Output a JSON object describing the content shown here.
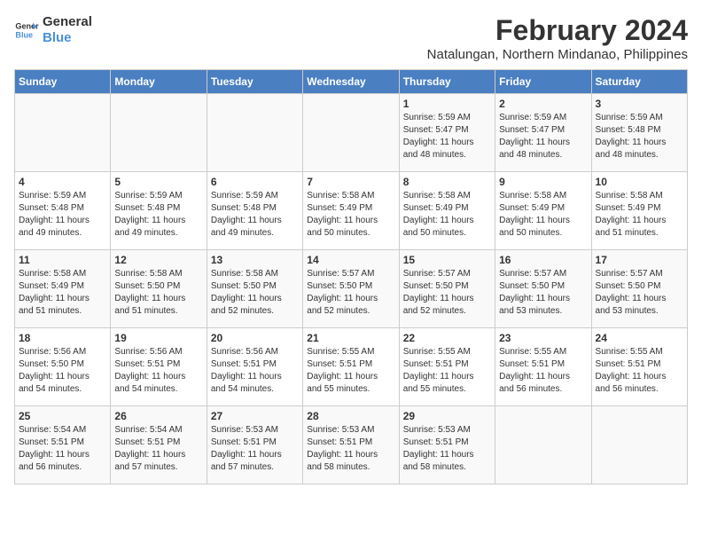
{
  "logo": {
    "line1": "General",
    "line2": "Blue"
  },
  "title": "February 2024",
  "location": "Natalungan, Northern Mindanao, Philippines",
  "days_of_week": [
    "Sunday",
    "Monday",
    "Tuesday",
    "Wednesday",
    "Thursday",
    "Friday",
    "Saturday"
  ],
  "weeks": [
    [
      {
        "day": "",
        "text": ""
      },
      {
        "day": "",
        "text": ""
      },
      {
        "day": "",
        "text": ""
      },
      {
        "day": "",
        "text": ""
      },
      {
        "day": "1",
        "text": "Sunrise: 5:59 AM\nSunset: 5:47 PM\nDaylight: 11 hours\nand 48 minutes."
      },
      {
        "day": "2",
        "text": "Sunrise: 5:59 AM\nSunset: 5:47 PM\nDaylight: 11 hours\nand 48 minutes."
      },
      {
        "day": "3",
        "text": "Sunrise: 5:59 AM\nSunset: 5:48 PM\nDaylight: 11 hours\nand 48 minutes."
      }
    ],
    [
      {
        "day": "4",
        "text": "Sunrise: 5:59 AM\nSunset: 5:48 PM\nDaylight: 11 hours\nand 49 minutes."
      },
      {
        "day": "5",
        "text": "Sunrise: 5:59 AM\nSunset: 5:48 PM\nDaylight: 11 hours\nand 49 minutes."
      },
      {
        "day": "6",
        "text": "Sunrise: 5:59 AM\nSunset: 5:48 PM\nDaylight: 11 hours\nand 49 minutes."
      },
      {
        "day": "7",
        "text": "Sunrise: 5:58 AM\nSunset: 5:49 PM\nDaylight: 11 hours\nand 50 minutes."
      },
      {
        "day": "8",
        "text": "Sunrise: 5:58 AM\nSunset: 5:49 PM\nDaylight: 11 hours\nand 50 minutes."
      },
      {
        "day": "9",
        "text": "Sunrise: 5:58 AM\nSunset: 5:49 PM\nDaylight: 11 hours\nand 50 minutes."
      },
      {
        "day": "10",
        "text": "Sunrise: 5:58 AM\nSunset: 5:49 PM\nDaylight: 11 hours\nand 51 minutes."
      }
    ],
    [
      {
        "day": "11",
        "text": "Sunrise: 5:58 AM\nSunset: 5:49 PM\nDaylight: 11 hours\nand 51 minutes."
      },
      {
        "day": "12",
        "text": "Sunrise: 5:58 AM\nSunset: 5:50 PM\nDaylight: 11 hours\nand 51 minutes."
      },
      {
        "day": "13",
        "text": "Sunrise: 5:58 AM\nSunset: 5:50 PM\nDaylight: 11 hours\nand 52 minutes."
      },
      {
        "day": "14",
        "text": "Sunrise: 5:57 AM\nSunset: 5:50 PM\nDaylight: 11 hours\nand 52 minutes."
      },
      {
        "day": "15",
        "text": "Sunrise: 5:57 AM\nSunset: 5:50 PM\nDaylight: 11 hours\nand 52 minutes."
      },
      {
        "day": "16",
        "text": "Sunrise: 5:57 AM\nSunset: 5:50 PM\nDaylight: 11 hours\nand 53 minutes."
      },
      {
        "day": "17",
        "text": "Sunrise: 5:57 AM\nSunset: 5:50 PM\nDaylight: 11 hours\nand 53 minutes."
      }
    ],
    [
      {
        "day": "18",
        "text": "Sunrise: 5:56 AM\nSunset: 5:50 PM\nDaylight: 11 hours\nand 54 minutes."
      },
      {
        "day": "19",
        "text": "Sunrise: 5:56 AM\nSunset: 5:51 PM\nDaylight: 11 hours\nand 54 minutes."
      },
      {
        "day": "20",
        "text": "Sunrise: 5:56 AM\nSunset: 5:51 PM\nDaylight: 11 hours\nand 54 minutes."
      },
      {
        "day": "21",
        "text": "Sunrise: 5:55 AM\nSunset: 5:51 PM\nDaylight: 11 hours\nand 55 minutes."
      },
      {
        "day": "22",
        "text": "Sunrise: 5:55 AM\nSunset: 5:51 PM\nDaylight: 11 hours\nand 55 minutes."
      },
      {
        "day": "23",
        "text": "Sunrise: 5:55 AM\nSunset: 5:51 PM\nDaylight: 11 hours\nand 56 minutes."
      },
      {
        "day": "24",
        "text": "Sunrise: 5:55 AM\nSunset: 5:51 PM\nDaylight: 11 hours\nand 56 minutes."
      }
    ],
    [
      {
        "day": "25",
        "text": "Sunrise: 5:54 AM\nSunset: 5:51 PM\nDaylight: 11 hours\nand 56 minutes."
      },
      {
        "day": "26",
        "text": "Sunrise: 5:54 AM\nSunset: 5:51 PM\nDaylight: 11 hours\nand 57 minutes."
      },
      {
        "day": "27",
        "text": "Sunrise: 5:53 AM\nSunset: 5:51 PM\nDaylight: 11 hours\nand 57 minutes."
      },
      {
        "day": "28",
        "text": "Sunrise: 5:53 AM\nSunset: 5:51 PM\nDaylight: 11 hours\nand 58 minutes."
      },
      {
        "day": "29",
        "text": "Sunrise: 5:53 AM\nSunset: 5:51 PM\nDaylight: 11 hours\nand 58 minutes."
      },
      {
        "day": "",
        "text": ""
      },
      {
        "day": "",
        "text": ""
      }
    ]
  ]
}
